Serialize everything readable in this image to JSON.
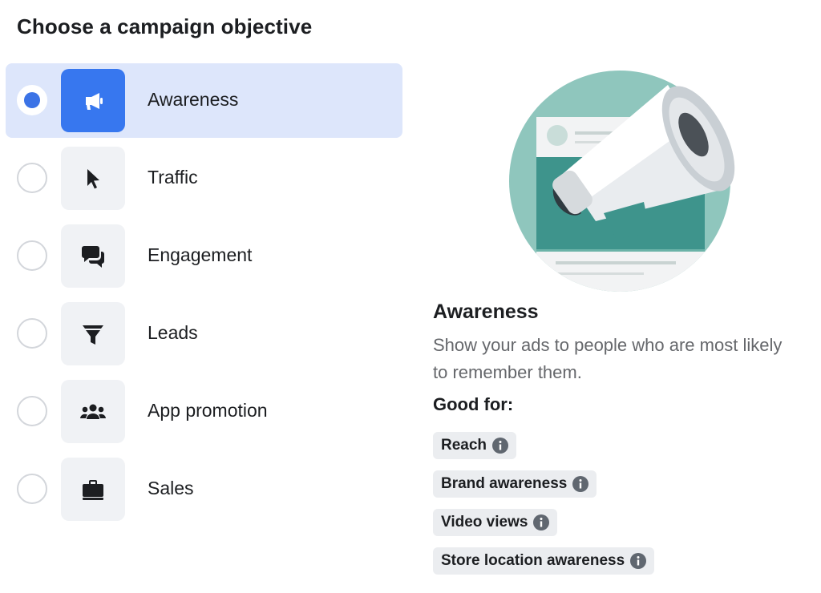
{
  "page": {
    "title": "Choose a campaign objective"
  },
  "objectives": [
    {
      "label": "Awareness",
      "icon": "megaphone-icon",
      "selected": true
    },
    {
      "label": "Traffic",
      "icon": "cursor-icon",
      "selected": false
    },
    {
      "label": "Engagement",
      "icon": "chat-bubbles-icon",
      "selected": false
    },
    {
      "label": "Leads",
      "icon": "funnel-icon",
      "selected": false
    },
    {
      "label": "App promotion",
      "icon": "people-icon",
      "selected": false
    },
    {
      "label": "Sales",
      "icon": "briefcase-icon",
      "selected": false
    }
  ],
  "detail": {
    "title": "Awareness",
    "description": "Show your ads to people who are most likely to remember them.",
    "good_for_label": "Good for:",
    "tags": [
      "Reach",
      "Brand awareness",
      "Video views",
      "Store location awareness"
    ]
  },
  "colors": {
    "accent": "#3777ef",
    "selected_background": "#dde6fb",
    "illustration_teal": "#8fc6bd",
    "illustration_dark_teal": "#3e948c"
  }
}
